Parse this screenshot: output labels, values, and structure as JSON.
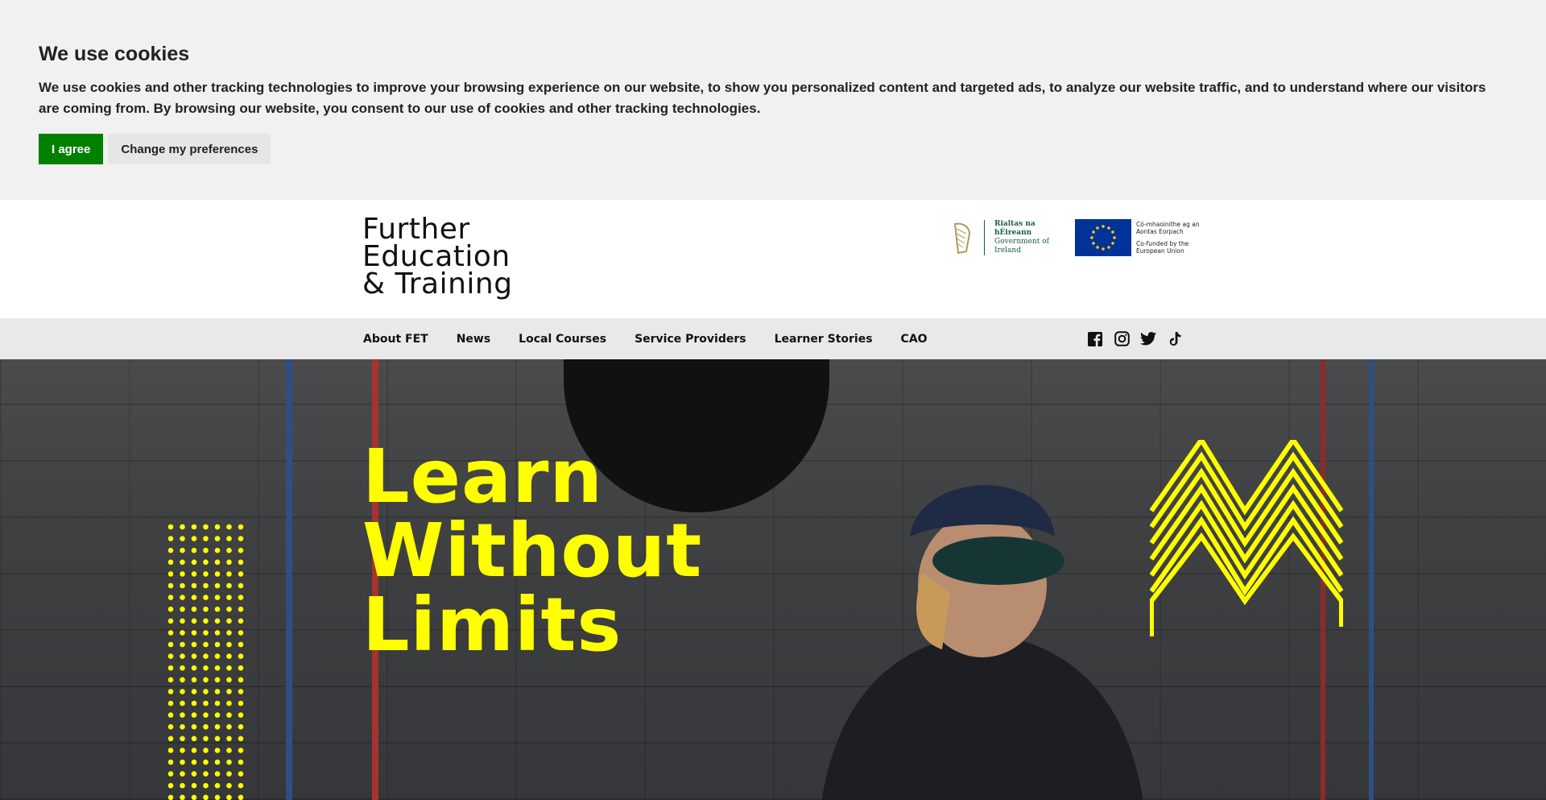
{
  "cookie_banner": {
    "title": "We use cookies",
    "text": "We use cookies and other tracking technologies to improve your browsing experience on our website, to show you personalized content and targeted ads, to analyze our website traffic, and to understand where our visitors are coming from. By browsing our website, you consent to our use of cookies and other tracking technologies.",
    "agree_label": "I agree",
    "prefs_label": "Change my preferences",
    "agree_color": "#008000"
  },
  "header": {
    "logo_lines": [
      "Further",
      "Education",
      "& Training"
    ],
    "gov_logo": {
      "irish": "Rialtas na hÉireann",
      "english": "Government of Ireland"
    },
    "eu_logo": {
      "irish": "Có-mhaoinithe ag an Aontas Eorpach",
      "english": "Co-funded by the European Union"
    }
  },
  "nav": {
    "items": [
      {
        "label": "About FET"
      },
      {
        "label": "News"
      },
      {
        "label": "Local Courses"
      },
      {
        "label": "Service Providers"
      },
      {
        "label": "Learner Stories"
      },
      {
        "label": "CAO"
      }
    ],
    "social": [
      "facebook-icon",
      "instagram-icon",
      "twitter-icon",
      "tiktok-icon"
    ]
  },
  "hero": {
    "title_lines": [
      "Learn",
      "Without",
      "Limits"
    ],
    "accent_color": "#ffff00"
  }
}
